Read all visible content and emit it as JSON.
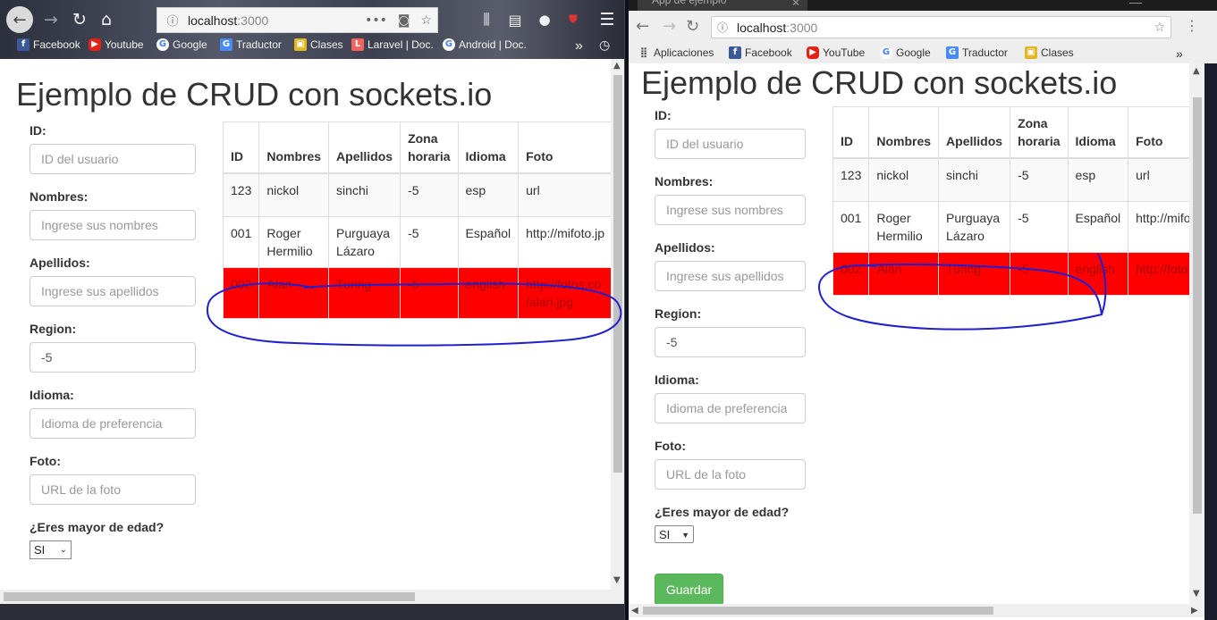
{
  "left_browser": {
    "url_host": "localhost",
    "url_port": ":3000",
    "bookmarks": [
      "Facebook",
      "Youtube",
      "Google",
      "Traductor",
      "Clases",
      "Laravel | Doc.",
      "Android | Doc."
    ],
    "overflow": "»"
  },
  "right_browser": {
    "tab_title": "App de ejemplo",
    "url_host": "localhost",
    "url_port": ":3000",
    "bookmarks": [
      "Aplicaciones",
      "Facebook",
      "YouTube",
      "Google",
      "Traductor",
      "Clases"
    ],
    "overflow": "»"
  },
  "page": {
    "title": "Ejemplo de CRUD con sockets.io",
    "form": {
      "id_label": "ID:",
      "id_placeholder": "ID del usuario",
      "nombres_label": "Nombres:",
      "nombres_placeholder": "Ingrese sus nombres",
      "apellidos_label": "Apellidos:",
      "apellidos_placeholder": "Ingrese sus apellidos",
      "region_label": "Region:",
      "region_value": "-5",
      "idioma_label": "Idioma:",
      "idioma_placeholder": "Idioma de preferencia",
      "foto_label": "Foto:",
      "foto_placeholder": "URL de la foto",
      "mayor_label": "¿Eres mayor de edad?",
      "mayor_value": "SI",
      "save_label": "Guardar"
    },
    "table": {
      "headers": [
        "ID",
        "Nombres",
        "Apellidos",
        "Zona horaria",
        "Idioma",
        "Foto"
      ],
      "zona_line1": "Zona",
      "zona_line2": "horaria",
      "rows": [
        {
          "id": "123",
          "nombres": "nickol",
          "apellidos": "sinchi",
          "zona": "-5",
          "idioma": "esp",
          "foto": "url"
        },
        {
          "id": "001",
          "nombres_1": "Roger",
          "nombres_2": "Hermilio",
          "apellidos_1": "Purguaya",
          "apellidos_2": "Lázaro",
          "zona": "-5",
          "idioma": "Español",
          "foto_left": "http://mifoto.jp",
          "foto_right": "http://mifo"
        },
        {
          "id": "002",
          "nombres": "Alan",
          "apellidos": "Turing",
          "zona": "-5",
          "idioma": "english",
          "foto_left_1": "http://fotos.co",
          "foto_left_2": "/alan.jpg",
          "foto_right": "http://foto"
        }
      ]
    }
  },
  "colors": {
    "highlight_row": "#ff0000",
    "annotation": "#1f1fd0",
    "save_button": "#5cb85c"
  }
}
